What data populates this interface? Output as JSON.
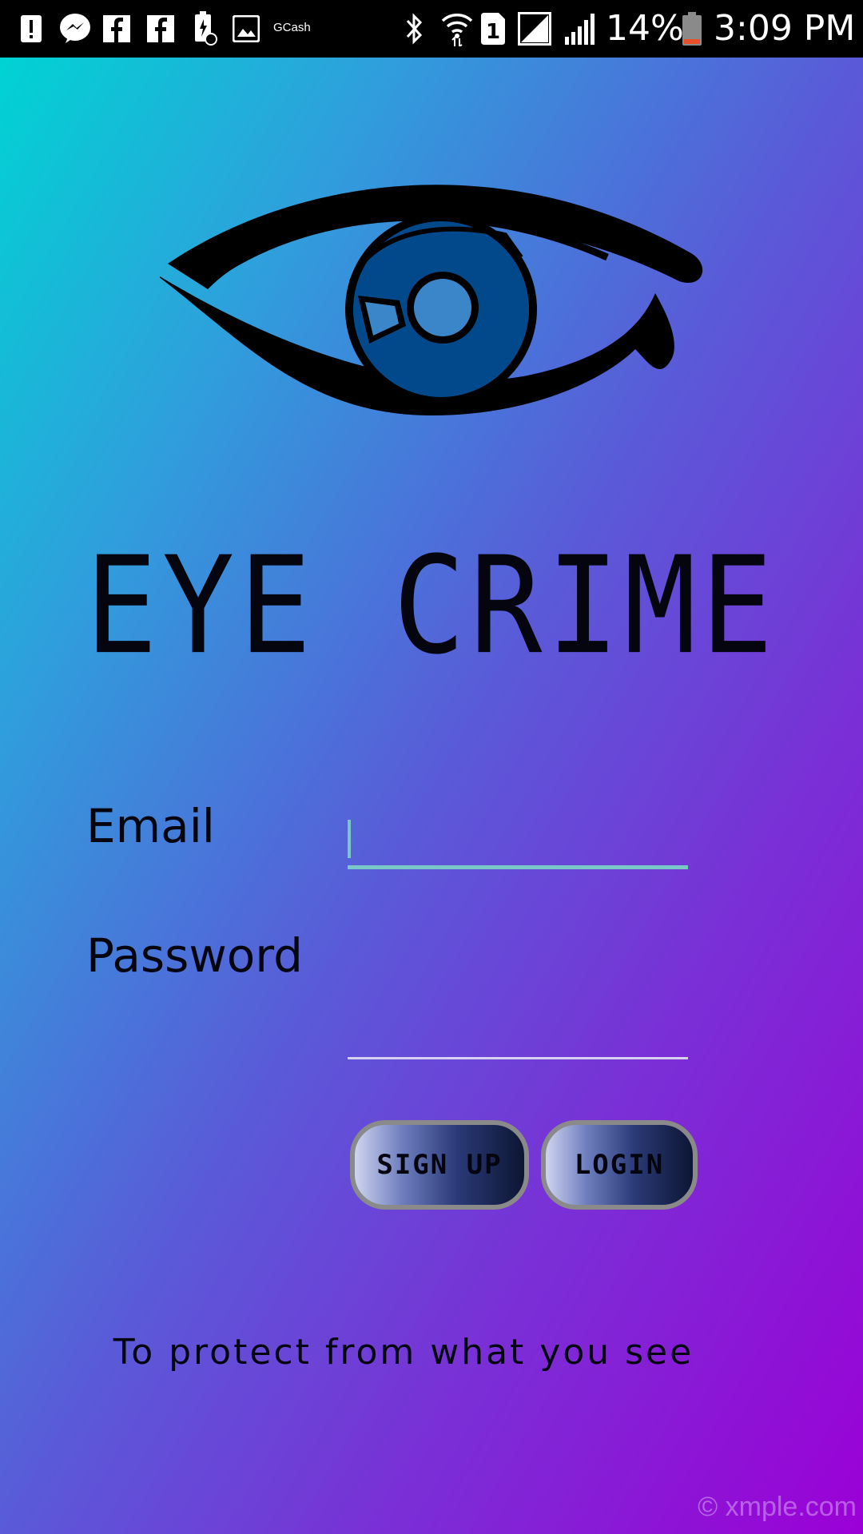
{
  "status_bar": {
    "left_icons": [
      "alert-icon",
      "messenger-icon",
      "facebook-icon",
      "facebook-icon",
      "battery-saver-icon",
      "image-icon"
    ],
    "gcash_label": "GCash",
    "right_icons": [
      "bluetooth-icon",
      "wifi-icon",
      "sim-1-icon",
      "signal-icon",
      "signal-icon"
    ],
    "battery_percent": "14%",
    "time": "3:09 PM"
  },
  "app": {
    "title": "EYE CRIME",
    "tagline": "To protect from what you see",
    "watermark": "© xmple.com"
  },
  "form": {
    "email_label": "Email",
    "email_value": "",
    "password_label": "Password",
    "password_value": ""
  },
  "buttons": {
    "signup_label": "SIGN UP",
    "login_label": "LOGIN"
  },
  "colors": {
    "gradient_start": "#00d3d3",
    "gradient_end": "#9b00d6",
    "email_underline": "#79c7c7",
    "password_underline": "#d8d0f0",
    "iris": "#02498c"
  }
}
